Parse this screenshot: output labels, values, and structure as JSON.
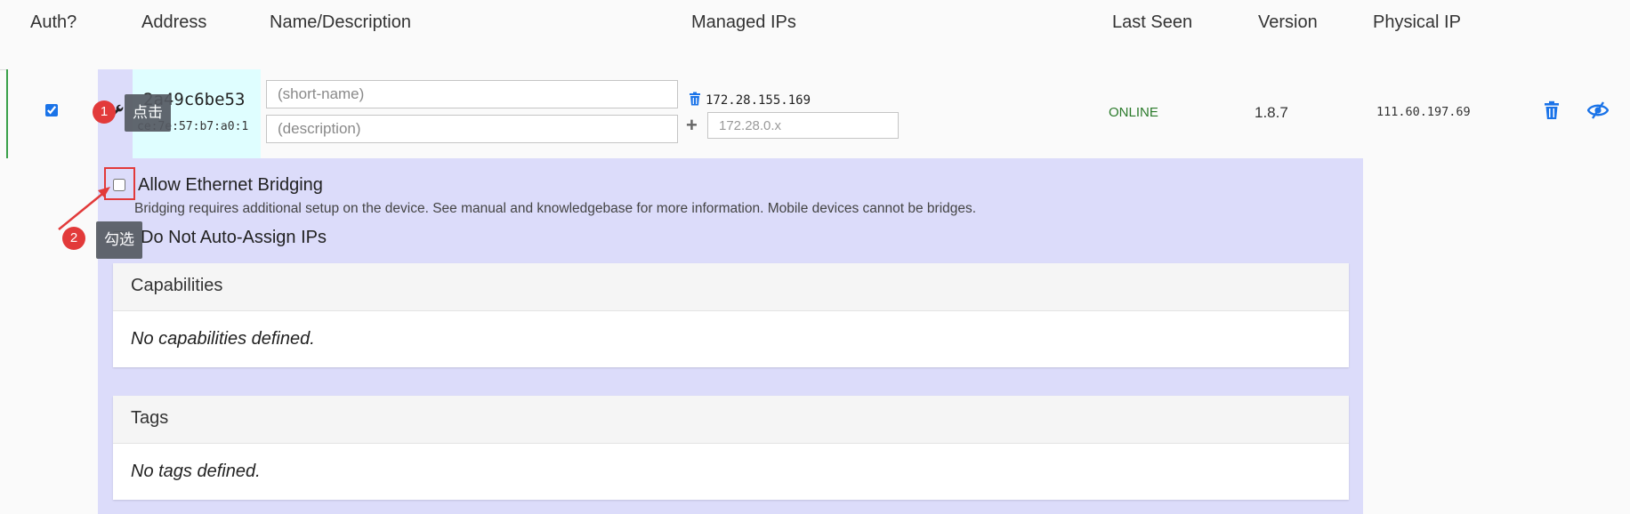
{
  "header": {
    "auth": "Auth?",
    "address": "Address",
    "name_desc": "Name/Description",
    "managed_ips": "Managed IPs",
    "last_seen": "Last Seen",
    "version": "Version",
    "physical_ip": "Physical IP"
  },
  "member": {
    "authorized": true,
    "address": "2a49c6be53",
    "mac": "ce:7e:57:b7:a0:1",
    "name_placeholder": "(short-name)",
    "description_placeholder": "(description)",
    "managed_ip": "172.28.155.169",
    "new_ip_placeholder": "172.28.0.x",
    "status": "ONLINE",
    "version": "1.8.7",
    "physical_ip": "111.60.197.69"
  },
  "settings": {
    "allow_bridging_label": "Allow Ethernet Bridging",
    "allow_bridging_checked": false,
    "bridging_help": "Bridging requires additional setup on the device. See manual and knowledgebase for more information. Mobile devices cannot be bridges.",
    "no_auto_assign_label": "Do Not Auto-Assign IPs",
    "no_auto_assign_checked": false
  },
  "capabilities": {
    "title": "Capabilities",
    "empty": "No capabilities defined."
  },
  "tags": {
    "title": "Tags",
    "empty": "No tags defined."
  },
  "annotations": [
    {
      "number": "1",
      "text": "点击"
    },
    {
      "number": "2",
      "text": "勾选"
    }
  ],
  "colors": {
    "accent": "#1a73e8",
    "online": "#2a7a2a",
    "annotation": "#e23a3a",
    "panel_bg": "#dcdcfa",
    "address_bg": "#dffeff"
  }
}
